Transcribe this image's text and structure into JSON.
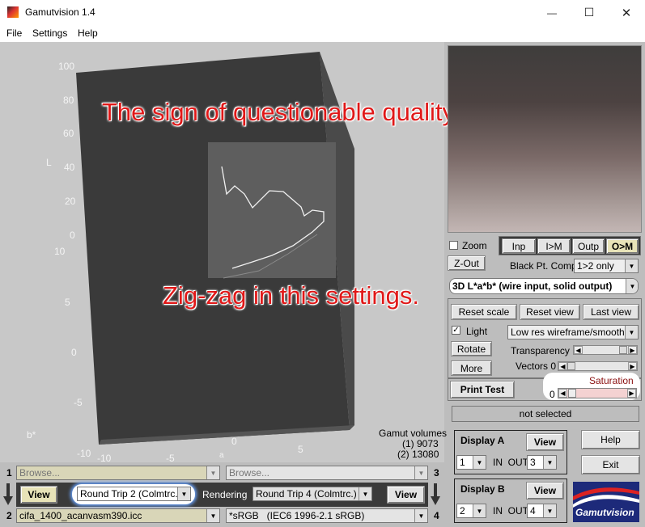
{
  "window": {
    "title": "Gamutvision 1.4",
    "minimize_glyph": "—",
    "maximize_glyph": "☐",
    "close_glyph": "✕"
  },
  "menu": {
    "file": "File",
    "settings": "Settings",
    "help": "Help"
  },
  "plot": {
    "l_ticks": [
      "100",
      "80",
      "60",
      "40",
      "20",
      "0"
    ],
    "l_axis_label": "L",
    "b_ticks": [
      "10",
      "5",
      "0",
      "-5",
      "-10"
    ],
    "b_axis_label": "b*",
    "a_ticks": [
      "-10",
      "-5",
      "0",
      "5"
    ],
    "a_axis_label": "a",
    "gamut_volumes_title": "Gamut volumes",
    "gamut_volume_1": "(1)  9073",
    "gamut_volume_2": "(2)  13080"
  },
  "annotations": {
    "top": "The sign of questionable quality:",
    "bottom": "Zig-zag in this settings."
  },
  "controls": {
    "zoom_label": "Zoom",
    "zout_label": "Z-Out",
    "mode_inp": "Inp",
    "mode_im": "I>M",
    "mode_outp": "Outp",
    "mode_om": "O>M",
    "black_pt_label": "Black Pt. Comp.",
    "black_pt_value": "1>2 only",
    "display_mode": "3D L*a*b* (wire input, solid output)",
    "reset_scale": "Reset scale",
    "reset_view": "Reset view",
    "last_view": "Last view",
    "light_label": "Light",
    "render_mode": "Low res wireframe/smooth",
    "rotate": "Rotate",
    "transparency_label": "Transparency 1",
    "more": "More",
    "vectors_label": "Vectors 0",
    "print_test": "Print Test",
    "saturation_label": "Saturation",
    "saturation_value": "0",
    "status": "not selected"
  },
  "display_a": {
    "title": "Display A",
    "view": "View",
    "in_value": "1",
    "in_out_label": "IN  OUT",
    "out_value": "3"
  },
  "display_b": {
    "title": "Display B",
    "view": "View",
    "in_value": "2",
    "in_out_label": "IN  OUT",
    "out_value": "4"
  },
  "side_buttons": {
    "help": "Help",
    "exit": "Exit"
  },
  "logo_text": "Gamutvision",
  "bottom": {
    "num1": "1",
    "num2": "2",
    "num3": "3",
    "num4": "4",
    "browse_left": "Browse...",
    "browse_right": "Browse...",
    "view_left": "View",
    "view_right": "View",
    "rendering_left": "Round Trip 2 (Colmtrc.)",
    "rendering_label": "Rendering",
    "rendering_right": "Round Trip 4 (Colmtrc.)",
    "profile_left": "cifa_1400_acanvasm390.icc",
    "profile_right": "*sRGB   (IEC6 1996-2.1 sRGB)"
  }
}
